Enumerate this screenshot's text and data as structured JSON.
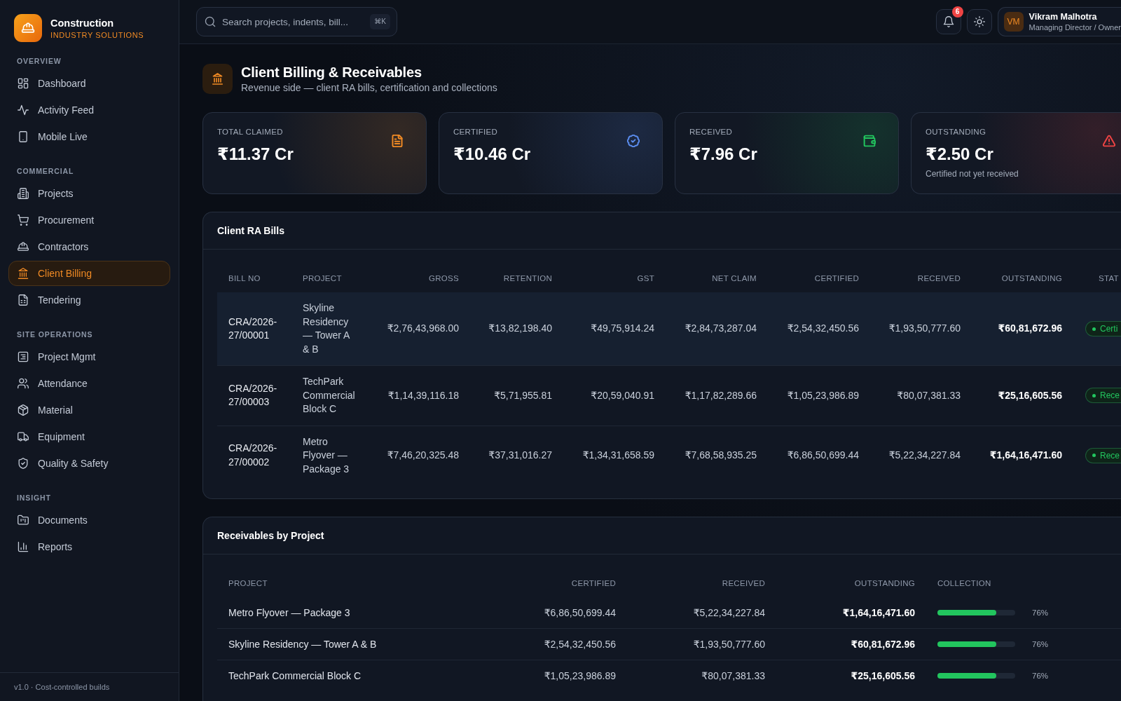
{
  "sidebar": {
    "brand": {
      "name": "Construction",
      "tagline": "INDUSTRY SOLUTIONS"
    },
    "sections": [
      {
        "title": "OVERVIEW",
        "items": [
          {
            "label": "Dashboard",
            "selected": false
          },
          {
            "label": "Activity Feed",
            "selected": false
          },
          {
            "label": "Mobile Live",
            "selected": false
          }
        ]
      },
      {
        "title": "COMMERCIAL",
        "items": [
          {
            "label": "Projects",
            "selected": false
          },
          {
            "label": "Procurement",
            "selected": false
          },
          {
            "label": "Contractors",
            "selected": false
          },
          {
            "label": "Client Billing",
            "selected": true
          },
          {
            "label": "Tendering",
            "selected": false
          }
        ]
      },
      {
        "title": "SITE OPERATIONS",
        "items": [
          {
            "label": "Project Mgmt",
            "selected": false
          },
          {
            "label": "Attendance",
            "selected": false
          },
          {
            "label": "Material",
            "selected": false
          },
          {
            "label": "Equipment",
            "selected": false
          },
          {
            "label": "Quality & Safety",
            "selected": false
          }
        ]
      },
      {
        "title": "INSIGHT",
        "items": [
          {
            "label": "Documents",
            "selected": false
          },
          {
            "label": "Reports",
            "selected": false
          }
        ]
      }
    ],
    "footer": "v1.0 · Cost-controlled builds"
  },
  "top_bar": {
    "search": {
      "placeholder": "Search projects, indents, bill...",
      "shortcut": "⌘K"
    },
    "notifications": {
      "count": "6"
    },
    "user": {
      "initials": "VM",
      "name": "Vikram Malhotra",
      "role": "Managing Director / Owner"
    }
  },
  "page_header": {
    "title": "Client Billing & Receivables",
    "subtitle": "Revenue side — client RA bills, certification and collections"
  },
  "stats": [
    {
      "kind": "claimed",
      "label": "TOTAL CLAIMED",
      "value": "₹11.37 Cr",
      "color": "#f08a24"
    },
    {
      "kind": "certified",
      "label": "CERTIFIED",
      "value": "₹10.46 Cr",
      "color": "#5b8def"
    },
    {
      "kind": "received",
      "label": "RECEIVED",
      "value": "₹7.96 Cr",
      "color": "#22c55e"
    },
    {
      "kind": "outstanding",
      "label": "OUTSTANDING",
      "value": "₹2.50 Cr",
      "note": "Certified not yet received",
      "color": "#ef4444"
    }
  ],
  "ra_bills": {
    "title": "Client RA Bills",
    "columns": [
      "BILL NO",
      "PROJECT",
      "GROSS",
      "RETENTION",
      "GST",
      "NET CLAIM",
      "CERTIFIED",
      "RECEIVED",
      "OUTSTANDING",
      "STAT"
    ],
    "rows": [
      {
        "selected": true,
        "cells": [
          "CRA/2026-27/00001",
          "Skyline Residency — Tower A & B",
          "₹2,76,43,968.00",
          "₹13,82,198.40",
          "₹49,75,914.24",
          "₹2,84,73,287.04",
          "₹2,54,32,450.56",
          "₹1,93,50,777.60",
          "₹60,81,672.96",
          "Certi"
        ]
      },
      {
        "selected": false,
        "cells": [
          "CRA/2026-27/00003",
          "TechPark Commercial Block C",
          "₹1,14,39,116.18",
          "₹5,71,955.81",
          "₹20,59,040.91",
          "₹1,17,82,289.66",
          "₹1,05,23,986.89",
          "₹80,07,381.33",
          "₹25,16,605.56",
          "Rece"
        ]
      },
      {
        "selected": false,
        "cells": [
          "CRA/2026-27/00002",
          "Metro Flyover — Package 3",
          "₹7,46,20,325.48",
          "₹37,31,016.27",
          "₹1,34,31,658.59",
          "₹7,68,58,935.25",
          "₹6,86,50,699.44",
          "₹5,22,34,227.84",
          "₹1,64,16,471.60",
          "Rece"
        ]
      }
    ]
  },
  "receivables": {
    "title": "Receivables by Project",
    "columns": [
      "PROJECT",
      "CERTIFIED",
      "RECEIVED",
      "OUTSTANDING",
      "COLLECTION"
    ],
    "rows": [
      {
        "cells": [
          "Metro Flyover — Package 3",
          "₹6,86,50,699.44",
          "₹5,22,34,227.84",
          "₹1,64,16,471.60"
        ],
        "level": 0.76,
        "percent": "76%"
      },
      {
        "cells": [
          "Skyline Residency — Tower A & B",
          "₹2,54,32,450.56",
          "₹1,93,50,777.60",
          "₹60,81,672.96"
        ],
        "level": 0.76,
        "percent": "76%"
      },
      {
        "cells": [
          "TechPark Commercial Block C",
          "₹1,05,23,986.89",
          "₹80,07,381.33",
          "₹25,16,605.56"
        ],
        "level": 0.76,
        "percent": "76%"
      }
    ]
  }
}
